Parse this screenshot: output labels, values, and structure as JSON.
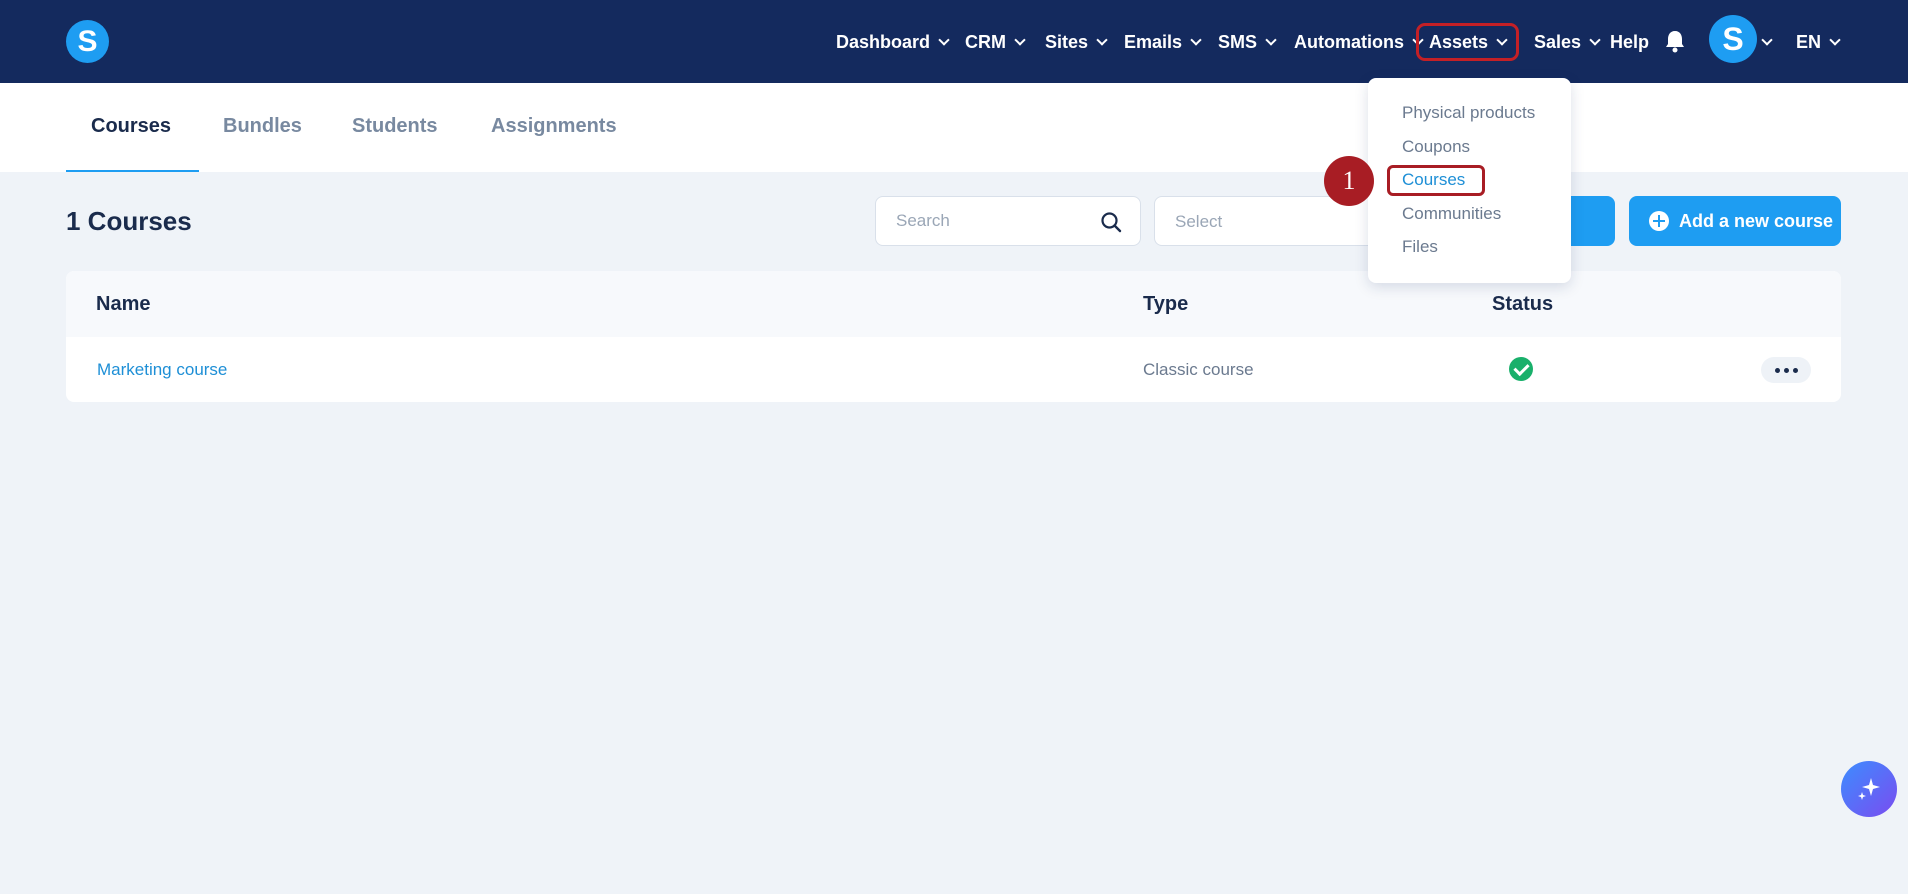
{
  "app": {
    "logo_letter": "S"
  },
  "nav": {
    "items": [
      {
        "label": "Dashboard"
      },
      {
        "label": "CRM"
      },
      {
        "label": "Sites"
      },
      {
        "label": "Emails"
      },
      {
        "label": "SMS"
      },
      {
        "label": "Automations"
      },
      {
        "label": "Assets"
      },
      {
        "label": "Sales"
      },
      {
        "label": "Help"
      }
    ],
    "avatar_letter": "S",
    "language": "EN"
  },
  "tabs": [
    {
      "label": "Courses",
      "active": true
    },
    {
      "label": "Bundles"
    },
    {
      "label": "Students"
    },
    {
      "label": "Assignments"
    }
  ],
  "toolbar": {
    "title": "1 Courses",
    "search_placeholder": "Search",
    "select_placeholder": "Select",
    "add_label": "Add a new course"
  },
  "table": {
    "headers": [
      "Name",
      "Type",
      "Status"
    ],
    "rows": [
      {
        "name": "Marketing course",
        "type": "Classic course",
        "status": "published"
      }
    ]
  },
  "assets_menu": {
    "items": [
      {
        "label": "Physical products"
      },
      {
        "label": "Coupons"
      },
      {
        "label": "Courses",
        "active": true
      },
      {
        "label": "Communities"
      },
      {
        "label": "Files"
      }
    ]
  },
  "annotation": {
    "step": "1"
  },
  "colors": {
    "nav_bg": "#142a5e",
    "accent": "#1e9df2",
    "highlight": "#a81d24",
    "status_ok": "#19b06b"
  }
}
